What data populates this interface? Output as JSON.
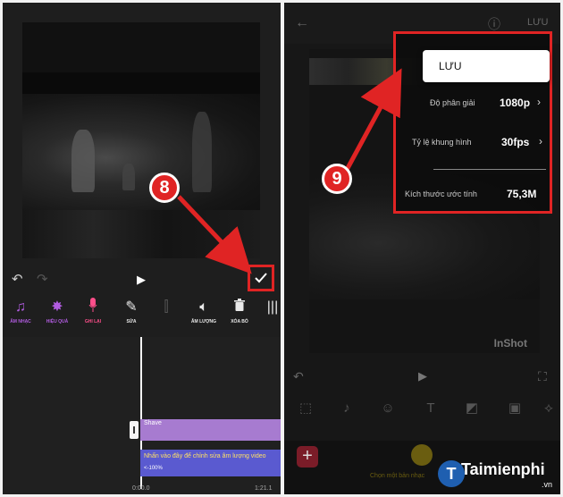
{
  "left": {
    "tools": [
      {
        "label": "ÂM NHẠC",
        "icon": "music-icon"
      },
      {
        "label": "HIỆU QUẢ",
        "icon": "effect-icon"
      },
      {
        "label": "GHI LẠI",
        "icon": "mic-icon"
      },
      {
        "label": "SỬA",
        "icon": "edit-icon"
      },
      {
        "label": "",
        "icon": "split-icon"
      },
      {
        "label": "ÂM LƯỢNG",
        "icon": "volume-icon"
      },
      {
        "label": "XÓA BỎ",
        "icon": "trash-icon"
      },
      {
        "label": "",
        "icon": "waveform-icon"
      }
    ],
    "clip_shave": "Shave",
    "clip_volume_hint": "Nhấn vào đây để chỉnh sửa âm lượng video",
    "clip_volume_percent": "<-100%",
    "time_start": "0:00.0",
    "time_end": "1:21.1",
    "step_badge": "8"
  },
  "right": {
    "save_label": "LƯU",
    "menu_save": "LƯU",
    "settings": [
      {
        "label": "Độ phân giải",
        "value": "1080p"
      },
      {
        "label": "Tỷ lệ khung hình",
        "value": "30fps"
      },
      {
        "label": "Kích thước ước tính",
        "value": "75,3M"
      }
    ],
    "watermark": "InShot",
    "hint": "Chọn một bản nhạc",
    "step_badge": "9",
    "logo": "Taimienphi",
    "logo_sub": ".vn"
  },
  "colors": {
    "highlight": "#e02424",
    "purple": "#b15ce0",
    "pink": "#ff4f8b",
    "clip_purple": "#a77bd0",
    "clip_blue": "#5a5ad0"
  }
}
